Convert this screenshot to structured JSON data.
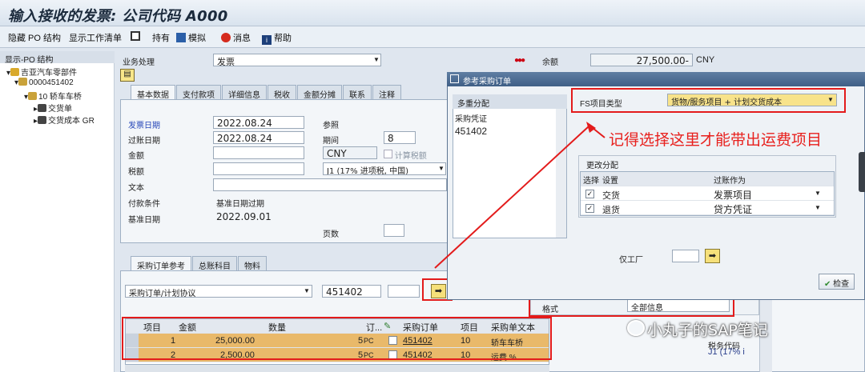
{
  "title": "输入接收的发票: 公司代码 A000",
  "toolbar": {
    "hide_po": "隐藏 PO 结构",
    "show_worklist": "显示工作清单",
    "hold": "持有",
    "simulate": "模拟",
    "messages": "消息",
    "help": "帮助"
  },
  "tree": {
    "header": "显示-PO 结构",
    "nodes": [
      "吉亚汽车零部件",
      "0000451402",
      "10 轿车车桥",
      "交货单",
      "交货成本 GR"
    ]
  },
  "header": {
    "transaction_label": "业务处理",
    "transaction_value": "发票",
    "balance_label": "余额",
    "balance_value": "27,500.00-",
    "currency": "CNY"
  },
  "basic_tabs": [
    "基本数据",
    "支付款项",
    "详细信息",
    "税收",
    "金额分摊",
    "联系",
    "注释"
  ],
  "basic": {
    "invoice_date_label": "发票日期",
    "invoice_date": "2022.08.24",
    "posting_date_label": "过账日期",
    "posting_date": "2022.08.24",
    "amount_label": "金额",
    "amount_currency": "CNY",
    "calc_tax": "计算税额",
    "tax_label": "税额",
    "tax_code": "J1 (17% 进项税, 中国)",
    "text_label": "文本",
    "payment_terms_label": "付款条件",
    "payment_terms": "基准日期过期",
    "baseline_label": "基准日期",
    "baseline": "2022.09.01",
    "reference_label": "参照",
    "period_label": "期间",
    "period": "8",
    "pages_label": "页数"
  },
  "lower_tabs": [
    "采购订单参考",
    "总账科目",
    "物料"
  ],
  "po_ref": {
    "type": "采购订单/计划协议",
    "po_number": "451402",
    "layout_label": "格式",
    "layout_value": "全部信息"
  },
  "items": {
    "headers": [
      "项目",
      "金额",
      "数量",
      "订...",
      "采购订单",
      "项目",
      "采购单文本",
      "税务代码"
    ],
    "rows": [
      {
        "item": "1",
        "amount": "25,000.00",
        "qty": "5",
        "unit": "PC",
        "po": "451402",
        "po_item": "10",
        "text": "轿车车桥",
        "tax": ""
      },
      {
        "item": "2",
        "amount": "2,500.00",
        "qty": "5",
        "unit": "PC",
        "po": "451402",
        "po_item": "10",
        "text": "运费 %",
        "tax": "J1 (17% i"
      }
    ]
  },
  "dialog": {
    "title": "参考采购订单",
    "multi_assign": "多重分配",
    "po_doc_label": "采购凭证",
    "po_doc_value": "451402",
    "fs_label": "FS项目类型",
    "fs_value": "货物/服务项目 + 计划交货成本",
    "change_assign": "更改分配",
    "col_select": "选择",
    "col_setting": "设置",
    "col_post_as": "过账作为",
    "rows": [
      {
        "setting": "交货",
        "post_as": "发票项目"
      },
      {
        "setting": "退货",
        "post_as": "贷方凭证"
      }
    ],
    "plant_label": "仅工厂",
    "check": "检查"
  },
  "annotation": "记得选择这里才能带出运费项目",
  "watermark": "小丸子的SAP笔记",
  "colors": {
    "red": "#e31b1b",
    "highlight": "#e9b96a"
  }
}
